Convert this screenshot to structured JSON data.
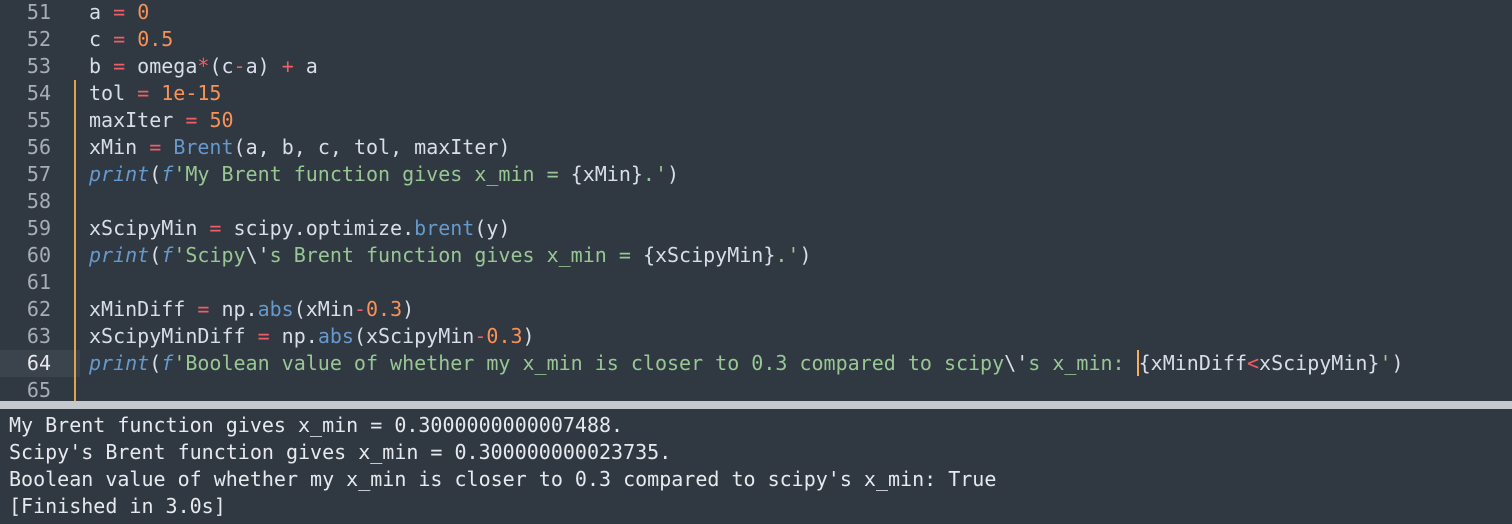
{
  "editor": {
    "lines": [
      {
        "num": "51",
        "mod": false,
        "tokens": [
          [
            "a",
            "p"
          ],
          [
            " ",
            "p"
          ],
          [
            "=",
            "op"
          ],
          [
            " ",
            "p"
          ],
          [
            "0",
            "num"
          ]
        ]
      },
      {
        "num": "52",
        "mod": false,
        "tokens": [
          [
            "c",
            "p"
          ],
          [
            " ",
            "p"
          ],
          [
            "=",
            "op"
          ],
          [
            " ",
            "p"
          ],
          [
            "0.5",
            "num"
          ]
        ]
      },
      {
        "num": "53",
        "mod": false,
        "tokens": [
          [
            "b",
            "p"
          ],
          [
            " ",
            "p"
          ],
          [
            "=",
            "op"
          ],
          [
            " omega",
            "p"
          ],
          [
            "*",
            "op"
          ],
          [
            "(c",
            "p"
          ],
          [
            "-",
            "op"
          ],
          [
            "a) ",
            "p"
          ],
          [
            "+",
            "op"
          ],
          [
            " a",
            "p"
          ]
        ]
      },
      {
        "num": "54",
        "mod": true,
        "tokens": [
          [
            "tol",
            "p"
          ],
          [
            " ",
            "p"
          ],
          [
            "=",
            "op"
          ],
          [
            " ",
            "p"
          ],
          [
            "1e-15",
            "num"
          ]
        ]
      },
      {
        "num": "55",
        "mod": true,
        "tokens": [
          [
            "maxIter",
            "p"
          ],
          [
            " ",
            "p"
          ],
          [
            "=",
            "op"
          ],
          [
            " ",
            "p"
          ],
          [
            "50",
            "num"
          ]
        ]
      },
      {
        "num": "56",
        "mod": true,
        "tokens": [
          [
            "xMin",
            "p"
          ],
          [
            " ",
            "p"
          ],
          [
            "=",
            "op"
          ],
          [
            " ",
            "p"
          ],
          [
            "Brent",
            "fn"
          ],
          [
            "(a, b, c, tol, maxIter)",
            "p"
          ]
        ]
      },
      {
        "num": "57",
        "mod": true,
        "tokens": [
          [
            "print",
            "it"
          ],
          [
            "(",
            "p"
          ],
          [
            "f",
            "it"
          ],
          [
            "'My Brent function gives x_min = ",
            "str"
          ],
          [
            "{xMin}",
            "p"
          ],
          [
            ".'",
            "str"
          ],
          [
            ")",
            "p"
          ]
        ]
      },
      {
        "num": "58",
        "mod": true,
        "tokens": []
      },
      {
        "num": "59",
        "mod": true,
        "tokens": [
          [
            "xScipyMin",
            "p"
          ],
          [
            " ",
            "p"
          ],
          [
            "=",
            "op"
          ],
          [
            " scipy.optimize.",
            "p"
          ],
          [
            "brent",
            "fn"
          ],
          [
            "(y)",
            "p"
          ]
        ]
      },
      {
        "num": "60",
        "mod": true,
        "tokens": [
          [
            "print",
            "it"
          ],
          [
            "(",
            "p"
          ],
          [
            "f",
            "it"
          ],
          [
            "'Scipy",
            "str"
          ],
          [
            "\\'",
            "p"
          ],
          [
            "s Brent function gives x_min = ",
            "str"
          ],
          [
            "{xScipyMin}",
            "p"
          ],
          [
            ".'",
            "str"
          ],
          [
            ")",
            "p"
          ]
        ]
      },
      {
        "num": "61",
        "mod": true,
        "tokens": []
      },
      {
        "num": "62",
        "mod": true,
        "tokens": [
          [
            "xMinDiff",
            "p"
          ],
          [
            " ",
            "p"
          ],
          [
            "=",
            "op"
          ],
          [
            " np.",
            "p"
          ],
          [
            "abs",
            "fn"
          ],
          [
            "(xMin",
            "p"
          ],
          [
            "-",
            "op"
          ],
          [
            "0.3",
            "num"
          ],
          [
            ")",
            "p"
          ]
        ]
      },
      {
        "num": "63",
        "mod": true,
        "tokens": [
          [
            "xScipyMinDiff",
            "p"
          ],
          [
            " ",
            "p"
          ],
          [
            "=",
            "op"
          ],
          [
            " np.",
            "p"
          ],
          [
            "abs",
            "fn"
          ],
          [
            "(xScipyMin",
            "p"
          ],
          [
            "-",
            "op"
          ],
          [
            "0.3",
            "num"
          ],
          [
            ")",
            "p"
          ]
        ]
      },
      {
        "num": "64",
        "mod": true,
        "current": true,
        "tokens": [
          [
            "print",
            "it"
          ],
          [
            "(",
            "p"
          ],
          [
            "f",
            "it"
          ],
          [
            "'Boolean value of whether my x_min is closer to 0.3 compared to scipy",
            "str"
          ],
          [
            "\\'",
            "p"
          ],
          [
            "s x_min: ",
            "str"
          ],
          [
            "|CURSOR|",
            "cursor"
          ],
          [
            "{xMinDiff",
            "p"
          ],
          [
            "<",
            "op"
          ],
          [
            "xScipyMin}",
            "p"
          ],
          [
            "'",
            "str"
          ],
          [
            ")",
            "p"
          ]
        ]
      },
      {
        "num": "65",
        "mod": true,
        "tokens": []
      }
    ]
  },
  "output": {
    "lines": [
      "My Brent function gives x_min = 0.3000000000007488.",
      "Scipy's Brent function gives x_min = 0.300000000023735.",
      "Boolean value of whether my x_min is closer to 0.3 compared to scipy's x_min: True",
      "[Finished in 3.0s]"
    ]
  },
  "colors": {
    "background": "#303841",
    "splitter": "#c5c8cc",
    "modified_marker": "#e0a44a",
    "cursor": "#f9ae58"
  }
}
